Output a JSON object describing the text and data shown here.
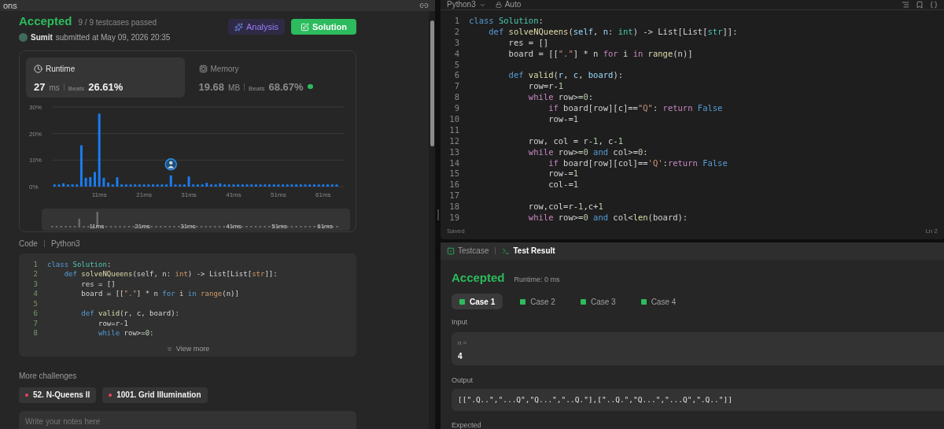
{
  "top_tab": {
    "label": "ons"
  },
  "submission": {
    "status": "Accepted",
    "passed": "9 / 9 testcases passed",
    "user": "Sumit",
    "submitted": "submitted at May 09, 2026 20:35"
  },
  "actions": [
    {
      "label": "Analysis",
      "kind": "analysis"
    },
    {
      "label": "Solution",
      "kind": "solution"
    }
  ],
  "stats": [
    {
      "title": "Runtime",
      "kind": "runtime",
      "value": "27",
      "unit": "ms",
      "beats_label": "Beats",
      "beats": "26.61%",
      "selected": true
    },
    {
      "title": "Memory",
      "kind": "memory",
      "value": "19.68",
      "unit": "MB",
      "beats_label": "Beats",
      "beats": "68.67%",
      "selected": false
    }
  ],
  "chart_data": {
    "type": "bar",
    "x": [
      1,
      2,
      3,
      4,
      5,
      6,
      7,
      8,
      9,
      10,
      11,
      12,
      13,
      14,
      15,
      16,
      17,
      18,
      19,
      20,
      21,
      22,
      23,
      24,
      25,
      26,
      27,
      28,
      29,
      30,
      31,
      32,
      33,
      34,
      35,
      36,
      37,
      38,
      39,
      40,
      41,
      42,
      43,
      44,
      45,
      46,
      47,
      48,
      49,
      50,
      51,
      52,
      53,
      54,
      55,
      56,
      57,
      58,
      59,
      60,
      61,
      62,
      63,
      64
    ],
    "series": [
      {
        "color": "#1a7cf0",
        "values": [
          0.8,
          0.8,
          1.2,
          0.8,
          0.8,
          0.8,
          15.6,
          3.3,
          3.6,
          5.5,
          27.5,
          3.3,
          1.5,
          0.8,
          3.5,
          0.8,
          0.8,
          0.8,
          0.8,
          0.8,
          0.8,
          0.8,
          0.8,
          0.8,
          0.8,
          0.8,
          4.2,
          0.8,
          0.8,
          0.8,
          3.8,
          0.8,
          0.8,
          0.8,
          1.4,
          0.8,
          0.8,
          1.2,
          0.8,
          0.8,
          0.8,
          0.8,
          0.8,
          0.8,
          0.8,
          0.8,
          0.8,
          0.8,
          0.8,
          0.8,
          0.8,
          0.8,
          0.8,
          0.8,
          0.8,
          0.8,
          0.8,
          0.8,
          0.8,
          0.8,
          0.8,
          0.8,
          0.8,
          0.8
        ]
      }
    ],
    "xlim": [
      0.6,
      65.6
    ],
    "ylim": [
      0,
      30
    ],
    "xticks": [
      {
        "value": 11,
        "label": "11ms"
      },
      {
        "value": 21,
        "label": "21ms"
      },
      {
        "value": 31,
        "label": "31ms"
      },
      {
        "value": 41,
        "label": "41ms"
      },
      {
        "value": 51,
        "label": "51ms"
      },
      {
        "value": 61,
        "label": "61ms"
      }
    ],
    "yticks": [
      {
        "value": 0,
        "label": "0%"
      },
      {
        "value": 10,
        "label": "10%"
      },
      {
        "value": 20,
        "label": "20%"
      },
      {
        "value": 30,
        "label": "30%"
      }
    ]
  },
  "navigator_labels": [
    "11ms",
    "21ms",
    "31ms",
    "41ms",
    "51ms",
    "61ms"
  ],
  "code_preview": {
    "label": "Code",
    "language": "Python3",
    "view_more": "View more",
    "lines": [
      {
        "n": "1",
        "tokens": [
          {
            "t": "class",
            "kind": "kw"
          },
          {
            "t": " Solution",
            "kind": "cls"
          },
          {
            "t": ":"
          }
        ]
      },
      {
        "n": "2",
        "tokens": [
          {
            "t": "    def",
            "kind": "kw"
          },
          {
            "t": " solveNQueens",
            "kind": "fn"
          },
          {
            "t": "(self, n: "
          },
          {
            "t": "int",
            "kind": "type"
          },
          {
            "t": ") -> List[List["
          },
          {
            "t": "str",
            "kind": "type"
          },
          {
            "t": "]]:"
          }
        ]
      },
      {
        "n": "3",
        "tokens": [
          {
            "t": "        res = []"
          }
        ]
      },
      {
        "n": "4",
        "tokens": [
          {
            "t": "        board = [["
          },
          {
            "t": "\".\"",
            "kind": "str"
          },
          {
            "t": "] * n "
          },
          {
            "t": "for",
            "kind": "kw"
          },
          {
            "t": " i "
          },
          {
            "t": "in",
            "kind": "kw"
          },
          {
            "t": " range",
            "kind": "type"
          },
          {
            "t": "(n)]"
          }
        ]
      },
      {
        "n": "5"
      },
      {
        "n": "6",
        "tokens": [
          {
            "t": "        def",
            "kind": "kw"
          },
          {
            "t": " valid",
            "kind": "fn"
          },
          {
            "t": "(r, c, board):"
          }
        ]
      },
      {
        "n": "7",
        "tokens": [
          {
            "t": "            row=r-1"
          }
        ]
      },
      {
        "n": "8",
        "tokens": [
          {
            "t": "            while",
            "kind": "kw"
          },
          {
            "t": " row>="
          },
          {
            "t": "0",
            "kind": "num"
          },
          {
            "t": ":"
          }
        ]
      }
    ]
  },
  "more_challenges": {
    "title": "More challenges",
    "items": [
      {
        "label": "52. N-Queens II",
        "color": "#f43f5e"
      },
      {
        "label": "1001. Grid Illumination",
        "color": "#f43f5e"
      }
    ]
  },
  "notes": {
    "placeholder": "Write your notes here"
  },
  "editor": {
    "language": "Python3",
    "mode": "Auto",
    "status": "Saved",
    "cursor": "Ln 2",
    "lines": [
      {
        "n": "1",
        "tokens": [
          {
            "t": "class",
            "kind": "kw"
          },
          {
            "t": " Solution",
            "kind": "cls"
          },
          {
            "t": ":"
          }
        ]
      },
      {
        "n": "2",
        "tokens": [
          {
            "t": "    def",
            "kind": "kw"
          },
          {
            "t": " solveNQueens",
            "kind": "fn"
          },
          {
            "t": "("
          },
          {
            "t": "self",
            "kind": "var"
          },
          {
            "t": ", "
          },
          {
            "t": "n",
            "kind": "var"
          },
          {
            "t": ": "
          },
          {
            "t": "int",
            "kind": "cls"
          },
          {
            "t": ") -> List[List["
          },
          {
            "t": "str",
            "kind": "cls"
          },
          {
            "t": "]]:"
          }
        ]
      },
      {
        "n": "3",
        "tokens": [
          {
            "t": "        res = []"
          }
        ]
      },
      {
        "n": "4",
        "tokens": [
          {
            "t": "        board = [["
          },
          {
            "t": "\".\"",
            "kind": "str"
          },
          {
            "t": "] * n "
          },
          {
            "t": "for",
            "kind": "ctrl"
          },
          {
            "t": " i "
          },
          {
            "t": "in",
            "kind": "ctrl"
          },
          {
            "t": " range",
            "kind": "fn"
          },
          {
            "t": "(n)]"
          }
        ]
      },
      {
        "n": "5"
      },
      {
        "n": "6",
        "tokens": [
          {
            "t": "        def",
            "kind": "kw"
          },
          {
            "t": " valid",
            "kind": "fn"
          },
          {
            "t": "("
          },
          {
            "t": "r",
            "kind": "var"
          },
          {
            "t": ", "
          },
          {
            "t": "c",
            "kind": "var"
          },
          {
            "t": ", "
          },
          {
            "t": "board",
            "kind": "var"
          },
          {
            "t": "):"
          }
        ]
      },
      {
        "n": "7",
        "tokens": [
          {
            "t": "            row=r-"
          },
          {
            "t": "1",
            "kind": "num"
          }
        ]
      },
      {
        "n": "8",
        "tokens": [
          {
            "t": "            while",
            "kind": "ctrl"
          },
          {
            "t": " row>="
          },
          {
            "t": "0",
            "kind": "num"
          },
          {
            "t": ":"
          }
        ]
      },
      {
        "n": "9",
        "tokens": [
          {
            "t": "                if",
            "kind": "ctrl"
          },
          {
            "t": " board[row][c]=="
          },
          {
            "t": "\"Q\"",
            "kind": "str"
          },
          {
            "t": ": "
          },
          {
            "t": "return",
            "kind": "ctrl"
          },
          {
            "t": " False",
            "kind": "kw"
          }
        ]
      },
      {
        "n": "10",
        "tokens": [
          {
            "t": "                row-="
          },
          {
            "t": "1",
            "kind": "num"
          }
        ]
      },
      {
        "n": "11"
      },
      {
        "n": "12",
        "tokens": [
          {
            "t": "            row, col = r-"
          },
          {
            "t": "1",
            "kind": "num"
          },
          {
            "t": ", c-"
          },
          {
            "t": "1",
            "kind": "num"
          }
        ]
      },
      {
        "n": "13",
        "tokens": [
          {
            "t": "            while",
            "kind": "ctrl"
          },
          {
            "t": " row>="
          },
          {
            "t": "0",
            "kind": "num"
          },
          {
            "t": " and",
            "kind": "kw"
          },
          {
            "t": " col>="
          },
          {
            "t": "0",
            "kind": "num"
          },
          {
            "t": ":"
          }
        ]
      },
      {
        "n": "14",
        "tokens": [
          {
            "t": "                if",
            "kind": "ctrl"
          },
          {
            "t": " board[row][col]=="
          },
          {
            "t": "'Q'",
            "kind": "str"
          },
          {
            "t": ":"
          },
          {
            "t": "return",
            "kind": "ctrl"
          },
          {
            "t": " False",
            "kind": "kw"
          }
        ]
      },
      {
        "n": "15",
        "tokens": [
          {
            "t": "                row-="
          },
          {
            "t": "1",
            "kind": "num"
          }
        ]
      },
      {
        "n": "16",
        "tokens": [
          {
            "t": "                col-="
          },
          {
            "t": "1",
            "kind": "num"
          }
        ]
      },
      {
        "n": "17"
      },
      {
        "n": "18",
        "tokens": [
          {
            "t": "            row,col=r-"
          },
          {
            "t": "1",
            "kind": "num"
          },
          {
            "t": ",c+"
          },
          {
            "t": "1",
            "kind": "num"
          }
        ]
      },
      {
        "n": "19",
        "tokens": [
          {
            "t": "            while",
            "kind": "ctrl"
          },
          {
            "t": " row>="
          },
          {
            "t": "0",
            "kind": "num"
          },
          {
            "t": " and",
            "kind": "kw"
          },
          {
            "t": " col<"
          },
          {
            "t": "len",
            "kind": "fn"
          },
          {
            "t": "(board):"
          }
        ]
      }
    ]
  },
  "result_panel": {
    "tabs": [
      {
        "label": "Testcase",
        "kind": "testcase",
        "selected": false
      },
      {
        "label": "Test Result",
        "kind": "result",
        "selected": true
      }
    ],
    "status": "Accepted",
    "runtime": "Runtime: 0 ms",
    "cases": [
      {
        "label": "Case 1",
        "selected": true
      },
      {
        "label": "Case 2",
        "selected": false
      },
      {
        "label": "Case 3",
        "selected": false
      },
      {
        "label": "Case 4",
        "selected": false
      }
    ],
    "input_label": "Input",
    "inputs": [
      {
        "name": "n =",
        "value": "4"
      }
    ],
    "output_label": "Output",
    "output": "[[\".Q..\",\"...Q\",\"Q...\",\"..Q.\"],[\"..Q.\",\"Q...\",\"...Q\",\".Q..\"]]",
    "expected_label": "Expected"
  }
}
